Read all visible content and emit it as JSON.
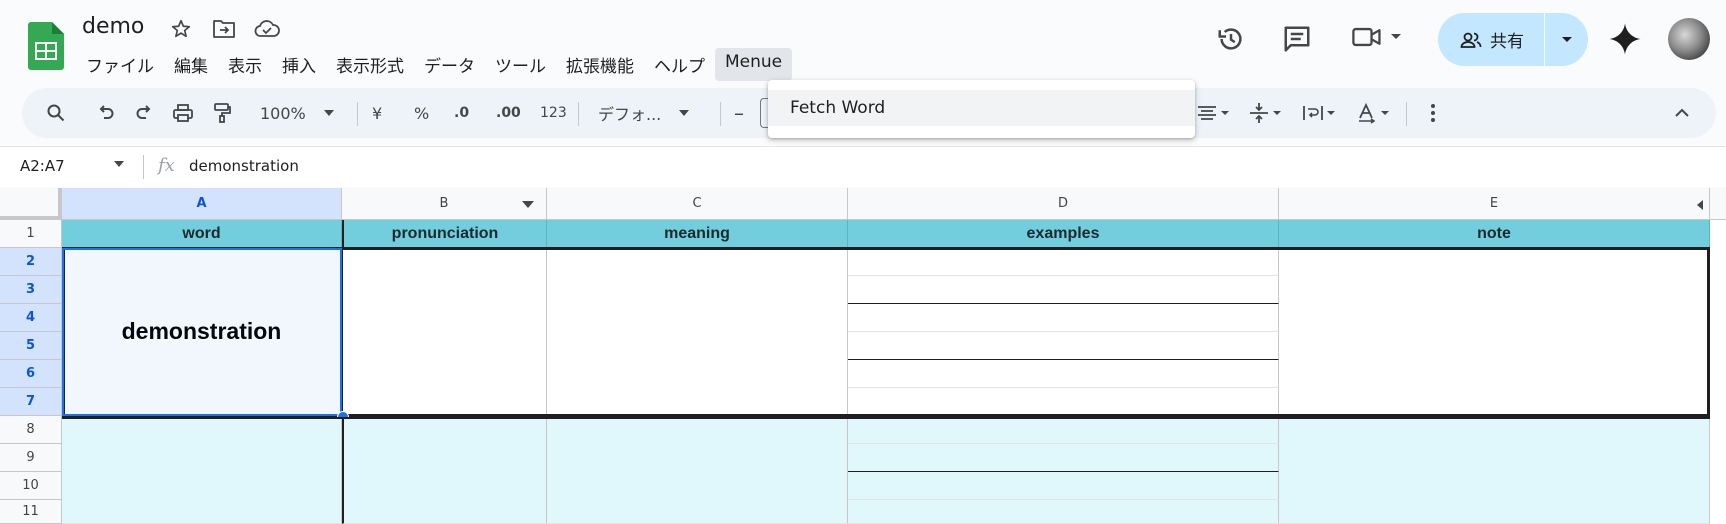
{
  "header": {
    "title": "demo",
    "menu": [
      "ファイル",
      "編集",
      "表示",
      "挿入",
      "表示形式",
      "データ",
      "ツール",
      "拡張機能",
      "ヘルプ",
      "Menue"
    ],
    "share_label": "共有",
    "icons": [
      "sheets-logo-icon",
      "star-icon",
      "move-folder-icon",
      "cloud-saved-icon",
      "version-history-icon",
      "comment-icon",
      "video-call-icon",
      "share-people-icon",
      "gemini-icon"
    ]
  },
  "toolbar": {
    "zoom": "100%",
    "currency": "¥",
    "percent": "%",
    "decrease_decimal": ".0",
    "increase_decimal": ".00",
    "number_format": "123",
    "font": "デフォ...",
    "minus": "–"
  },
  "formula_bar": {
    "name_box": "A2:A7",
    "fx": "fx",
    "content": "demonstration"
  },
  "sheet": {
    "columns": [
      "A",
      "B",
      "C",
      "D",
      "E"
    ],
    "rows": [
      "1",
      "2",
      "3",
      "4",
      "5",
      "6",
      "7",
      "8",
      "9",
      "10",
      "11"
    ],
    "header_row": [
      "word",
      "pronunciation",
      "meaning",
      "examples",
      "note"
    ],
    "merged_word": "demonstration",
    "colors": {
      "header_bg": "#72cddc",
      "alt_block_bg": "#e0f7fc",
      "selection": "#d3e3fd",
      "accent": "#0b57d0"
    }
  },
  "dropdown": {
    "item": "Fetch Word"
  }
}
